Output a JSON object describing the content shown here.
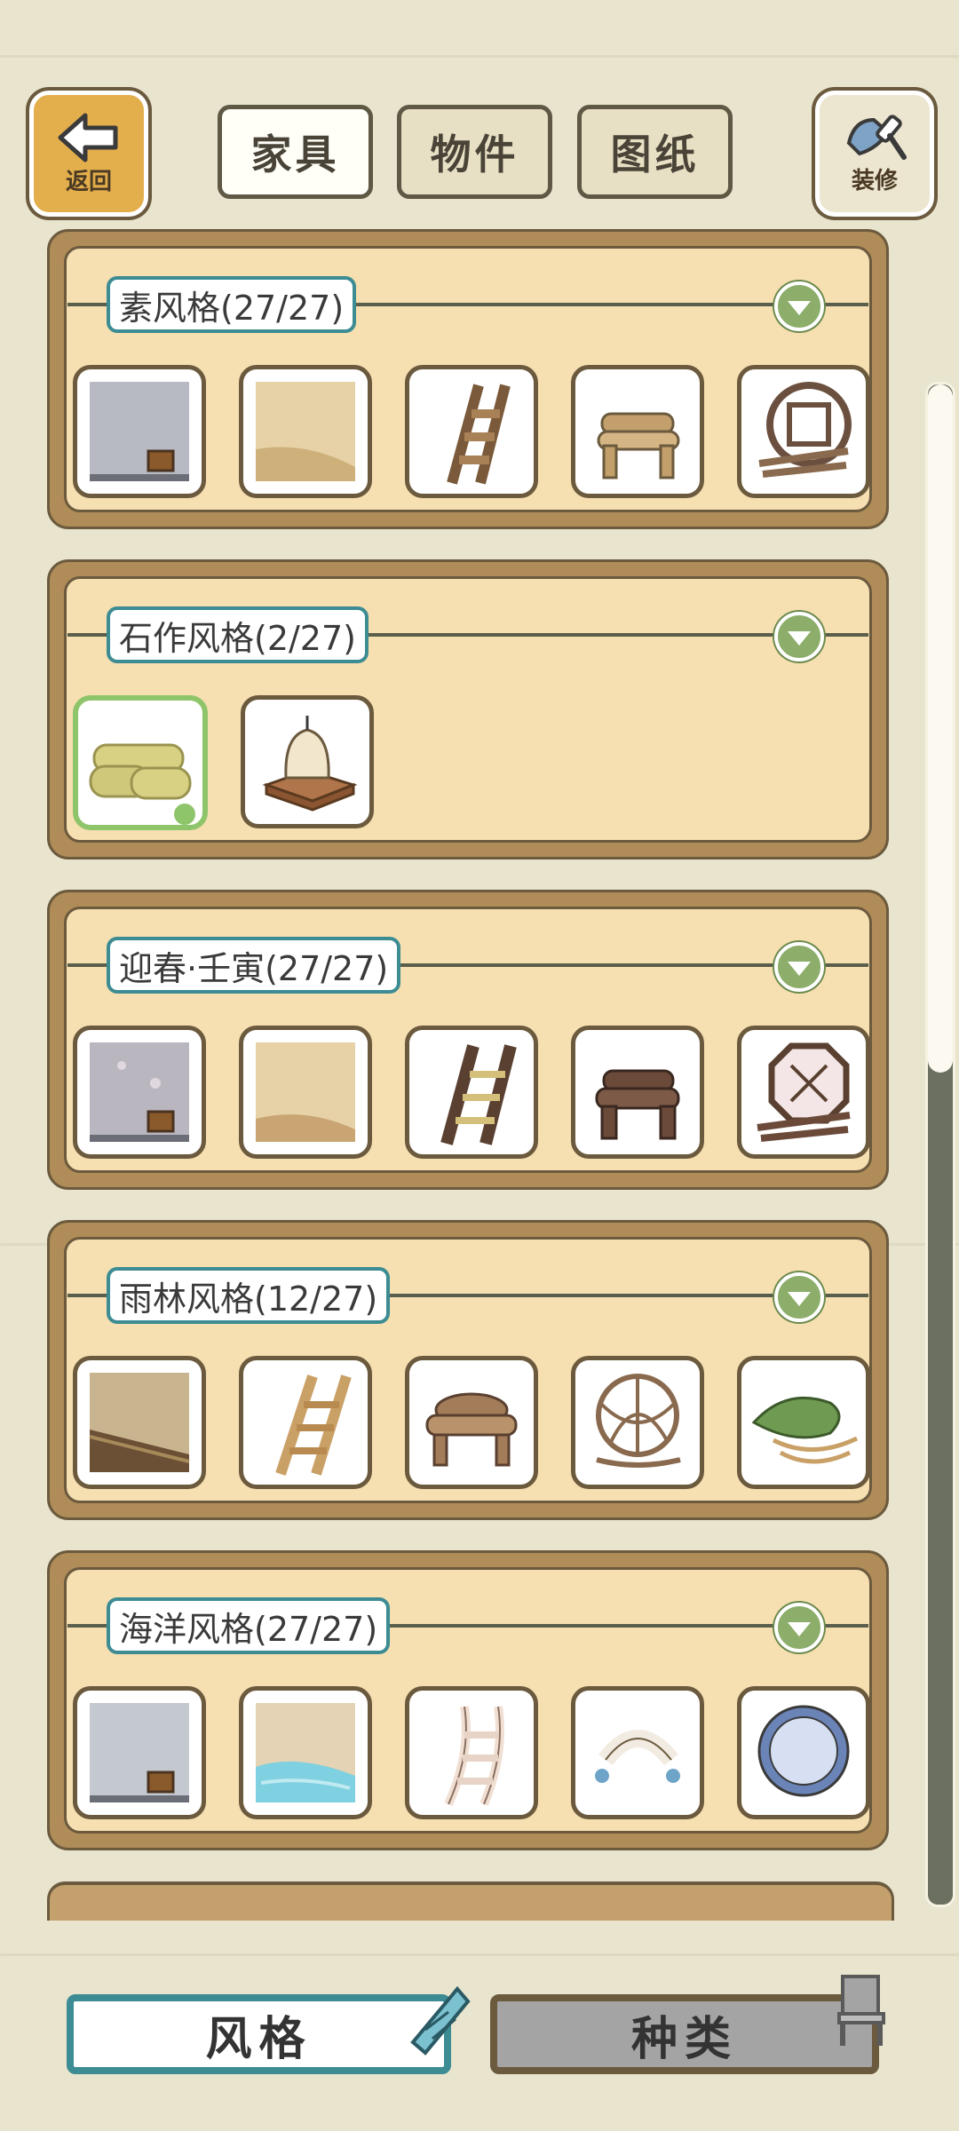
{
  "header": {
    "back_label": "返回",
    "decorate_label": "装修",
    "tabs": [
      {
        "label": "家具",
        "active": true
      },
      {
        "label": "物件",
        "active": false
      },
      {
        "label": "图纸",
        "active": false
      }
    ]
  },
  "sections": [
    {
      "title": "素风格(27/27)",
      "items": [
        "wall-item",
        "floor-item",
        "ladder-item",
        "log-bench-item",
        "window-item"
      ]
    },
    {
      "title": "石作风格(2/27)",
      "items": [
        "rug-roll-item",
        "stone-lamp-item"
      ]
    },
    {
      "title": "迎春·壬寅(27/27)",
      "items": [
        "wall-item",
        "floor-item",
        "ladder-item",
        "log-bench-item",
        "window-item"
      ]
    },
    {
      "title": "雨林风格(12/27)",
      "items": [
        "floor-item",
        "ladder-item",
        "log-table-item",
        "globe-item",
        "leaf-item"
      ]
    },
    {
      "title": "海洋风格(27/27)",
      "items": [
        "wall-item",
        "floor-item",
        "ladder-item",
        "shell-item",
        "porthole-item"
      ]
    }
  ],
  "bottom_nav": {
    "style_label": "风格",
    "kind_label": "种类"
  },
  "colors": {
    "accent": "#3d8c93",
    "card": "#b08c58",
    "card_inner": "#f6dfb0",
    "toggle": "#8cae6a",
    "back_button": "#e3ae4c"
  }
}
